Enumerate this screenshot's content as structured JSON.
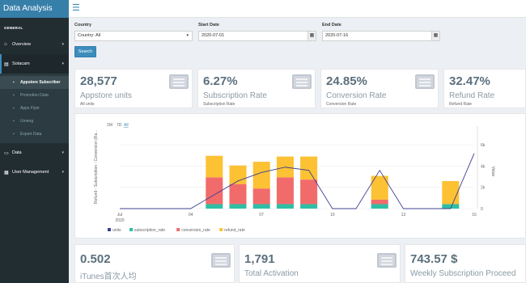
{
  "app": {
    "title": "Data Analysis"
  },
  "sidebar": {
    "header": "GENERAL",
    "items": [
      {
        "label": "Overview",
        "icon": "home-icon"
      },
      {
        "label": "Sotacam",
        "icon": "sticky-note-icon"
      },
      {
        "label": "Data",
        "icon": "folder-icon"
      },
      {
        "label": "User Management",
        "icon": "grid-icon"
      }
    ],
    "subitems": [
      {
        "label": "Appstore Subscriber",
        "active": true
      },
      {
        "label": "Promotion Data"
      },
      {
        "label": "Apps Flyer"
      },
      {
        "label": "Umeng"
      },
      {
        "label": "Export Data"
      }
    ]
  },
  "filters": {
    "country_label": "Country",
    "country_value": "Country: All",
    "start_label": "Start Date",
    "start_value": "2020-07-01",
    "end_label": "End Date",
    "end_value": "2020-07-16",
    "search_label": "Search"
  },
  "stats": [
    {
      "value": "28,577",
      "label": "Appstore units",
      "sub": "All units"
    },
    {
      "value": "6.27%",
      "label": "Subscription Rate",
      "sub": "Subscription Rate"
    },
    {
      "value": "24.85%",
      "label": "Conversion Rate",
      "sub": "Conversion Rate"
    },
    {
      "value": "32.47%",
      "label": "Refund Rate",
      "sub": "Refund Rate"
    }
  ],
  "bottom_stats": [
    {
      "value": "0.502",
      "label": "iTunes首次人均"
    },
    {
      "value": "1,791",
      "label": "Total Activation"
    },
    {
      "value": "743.57 $",
      "label": "Weekly Subscription Proceed"
    }
  ],
  "chart_controls": {
    "zoom_a": "1M",
    "zoom_b": "7D",
    "zoom_all": "All"
  },
  "colors": {
    "units": "#3c3f8f",
    "subscription_rate": "#2ebfa5",
    "conversion_rate": "#f26b6b",
    "refund_rate": "#fdc134",
    "brand": "#367fa9",
    "sidebar": "#222d32"
  },
  "chart_data": {
    "type": "bar",
    "title": "",
    "xlabel": "",
    "ylabel_left": "Refund - Subscription - Conversion (Ra...",
    "ylabel_right": "Value",
    "x_ticks": [
      "Jul\n2020",
      "04",
      "07",
      "10",
      "13",
      "16"
    ],
    "y_right_ticks": [
      "0",
      "2k",
      "4k",
      "6k"
    ],
    "ylim_right": [
      0,
      7000
    ],
    "ylim_left": [
      0,
      1
    ],
    "categories": [
      "07-01",
      "07-02",
      "07-03",
      "07-04",
      "07-05",
      "07-06",
      "07-07",
      "07-08",
      "07-09",
      "07-10",
      "07-11",
      "07-12",
      "07-13",
      "07-14",
      "07-15",
      "07-16"
    ],
    "series": [
      {
        "name": "subscription_rate",
        "kind": "bar",
        "values": [
          0,
          0,
          0,
          0,
          0.06,
          0.06,
          0.06,
          0.06,
          0.06,
          0,
          0,
          0.06,
          0,
          0,
          0.06,
          0
        ]
      },
      {
        "name": "conversion_rate",
        "kind": "bar",
        "values": [
          0,
          0,
          0,
          0,
          0.36,
          0.27,
          0.21,
          0.36,
          0.33,
          0,
          0,
          0.06,
          0,
          0,
          0,
          0
        ]
      },
      {
        "name": "refund_rate",
        "kind": "bar",
        "values": [
          0,
          0,
          0,
          0,
          0.29,
          0.25,
          0.36,
          0.28,
          0.31,
          0,
          0,
          0.32,
          0,
          0,
          0.31,
          0
        ]
      },
      {
        "name": "units",
        "kind": "line",
        "values": [
          0,
          0,
          0,
          0,
          1300,
          2600,
          3400,
          3900,
          3600,
          0,
          0,
          3600,
          0,
          0,
          0,
          5200
        ]
      }
    ],
    "legend": [
      "units",
      "subscription_rate",
      "conversion_rate",
      "refund_rate"
    ],
    "legend_position": "bottom-left",
    "grid": true
  }
}
